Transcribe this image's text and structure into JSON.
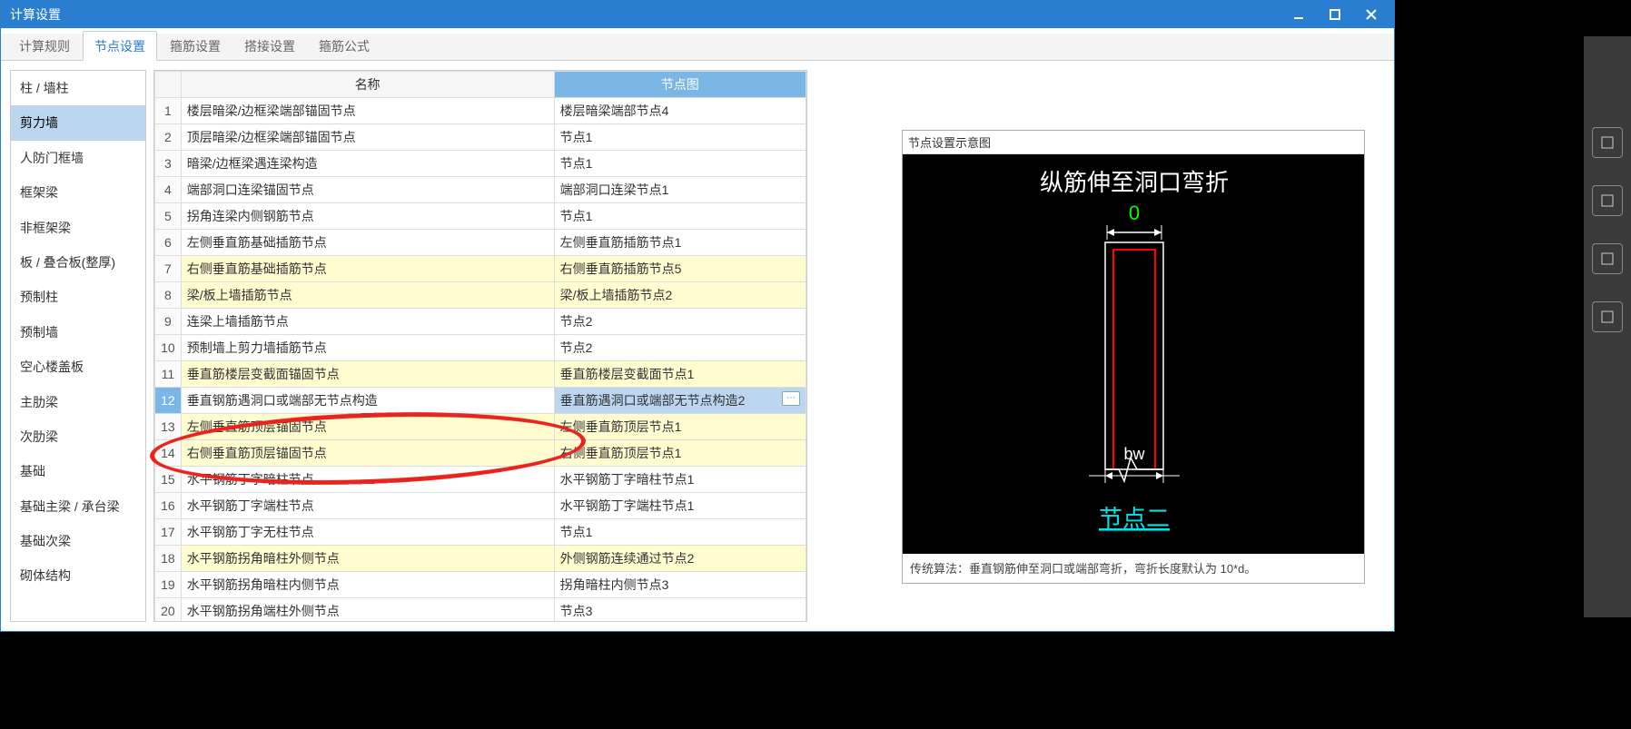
{
  "window": {
    "title": "计算设置"
  },
  "tabs": [
    {
      "label": "计算规则",
      "active": false
    },
    {
      "label": "节点设置",
      "active": true
    },
    {
      "label": "箍筋设置",
      "active": false
    },
    {
      "label": "搭接设置",
      "active": false
    },
    {
      "label": "箍筋公式",
      "active": false
    }
  ],
  "sidebar": {
    "items": [
      "柱 / 墙柱",
      "剪力墙",
      "人防门框墙",
      "框架梁",
      "非框架梁",
      "板 / 叠合板(整厚)",
      "预制柱",
      "预制墙",
      "空心楼盖板",
      "主肋梁",
      "次肋梁",
      "基础",
      "基础主梁 / 承台梁",
      "基础次梁",
      "砌体结构"
    ],
    "selected_index": 1
  },
  "table": {
    "headers": {
      "name": "名称",
      "node": "节点图"
    },
    "rows": [
      {
        "n": 1,
        "name": "楼层暗梁/边框梁端部锚固节点",
        "node": "楼层暗梁端部节点4",
        "hl": false
      },
      {
        "n": 2,
        "name": "顶层暗梁/边框梁端部锚固节点",
        "node": "节点1",
        "hl": false
      },
      {
        "n": 3,
        "name": "暗梁/边框梁遇连梁构造",
        "node": "节点1",
        "hl": false
      },
      {
        "n": 4,
        "name": "端部洞口连梁锚固节点",
        "node": "端部洞口连梁节点1",
        "hl": false
      },
      {
        "n": 5,
        "name": "拐角连梁内侧钢筋节点",
        "node": "节点1",
        "hl": false
      },
      {
        "n": 6,
        "name": "左侧垂直筋基础插筋节点",
        "node": "左侧垂直筋插筋节点1",
        "hl": false
      },
      {
        "n": 7,
        "name": "右侧垂直筋基础插筋节点",
        "node": "右侧垂直筋插筋节点5",
        "hl": true
      },
      {
        "n": 8,
        "name": "梁/板上墙插筋节点",
        "node": "梁/板上墙插筋节点2",
        "hl": true
      },
      {
        "n": 9,
        "name": "连梁上墙插筋节点",
        "node": "节点2",
        "hl": false
      },
      {
        "n": 10,
        "name": "预制墙上剪力墙插筋节点",
        "node": "节点2",
        "hl": false
      },
      {
        "n": 11,
        "name": "垂直筋楼层变截面锚固节点",
        "node": "垂直筋楼层变截面节点1",
        "hl": true
      },
      {
        "n": 12,
        "name": "垂直钢筋遇洞口或端部无节点构造",
        "node": "垂直筋遇洞口或端部无节点构造2",
        "hl": false,
        "selected": true
      },
      {
        "n": 13,
        "name": "左侧垂直筋顶层锚固节点",
        "node": "左侧垂直筋顶层节点1",
        "hl": true
      },
      {
        "n": 14,
        "name": "右侧垂直筋顶层锚固节点",
        "node": "右侧垂直筋顶层节点1",
        "hl": true
      },
      {
        "n": 15,
        "name": "水平钢筋丁字暗柱节点",
        "node": "水平钢筋丁字暗柱节点1",
        "hl": false
      },
      {
        "n": 16,
        "name": "水平钢筋丁字端柱节点",
        "node": "水平钢筋丁字端柱节点1",
        "hl": false
      },
      {
        "n": 17,
        "name": "水平钢筋丁字无柱节点",
        "node": "节点1",
        "hl": false
      },
      {
        "n": 18,
        "name": "水平钢筋拐角暗柱外侧节点",
        "node": "外侧钢筋连续通过节点2",
        "hl": true
      },
      {
        "n": 19,
        "name": "水平钢筋拐角暗柱内侧节点",
        "node": "拐角暗柱内侧节点3",
        "hl": false
      },
      {
        "n": 20,
        "name": "水平钢筋拐角端柱外侧节点",
        "node": "节点3",
        "hl": false
      }
    ]
  },
  "diagram": {
    "panel_title": "节点设置示意图",
    "heading": "纵筋伸至洞口弯折",
    "top_value": "0",
    "width_label": "bw",
    "label": "节点二",
    "caption": "传统算法：垂直钢筋伸至洞口或端部弯折，弯折长度默认为 10*d。"
  }
}
